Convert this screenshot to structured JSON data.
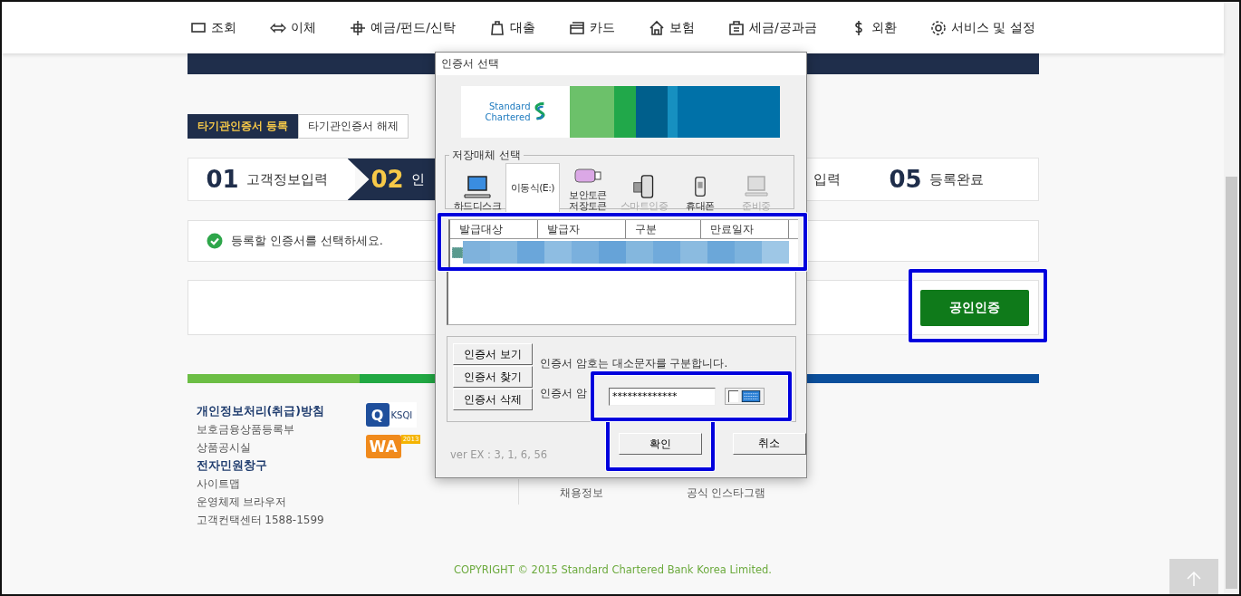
{
  "nav": [
    {
      "label": "조회"
    },
    {
      "label": "이체"
    },
    {
      "label": "예금/펀드/신탁"
    },
    {
      "label": "대출"
    },
    {
      "label": "카드"
    },
    {
      "label": "보험"
    },
    {
      "label": "세금/공과금"
    },
    {
      "label": "외환"
    },
    {
      "label": "서비스 및 설정"
    }
  ],
  "tabs": [
    {
      "label": "타기관인증서 등록",
      "selected": true
    },
    {
      "label": "타기관인증서 해제",
      "selected": false
    }
  ],
  "steps": [
    {
      "number": "01",
      "label": "고객정보입력",
      "selected": false
    },
    {
      "number": "02",
      "label": "인",
      "selected": true
    },
    {
      "label": "입력",
      "selected": false
    },
    {
      "number": "05",
      "label": "등록완료",
      "selected": false
    }
  ],
  "notice": "등록할 인증서를 선택하세요.",
  "certify_button": "공인인증",
  "footer": {
    "links": [
      {
        "label": "개인정보처리(취급)방침",
        "bold": true
      },
      {
        "label": "보호금융상품등록부",
        "bold": false
      },
      {
        "label": "상품공시실",
        "bold": false
      },
      {
        "label": "전자민원창구",
        "bold": true
      },
      {
        "label": "사이트맵",
        "bold": false
      },
      {
        "label": "운영체제 브라우저",
        "bold": false
      },
      {
        "label": "고객컨택센터 1588-1599",
        "bold": false
      }
    ],
    "badges": [
      {
        "mark": "Q",
        "label": "KSQI"
      },
      {
        "label": "WA",
        "year": "2013"
      }
    ],
    "extra_links": [
      "채용정보",
      "공식 인스타그램"
    ],
    "copyright": "COPYRIGHT © 2015 Standard Chartered Bank Korea Limited."
  },
  "dialog": {
    "title": "인증서 선택",
    "logo": [
      "Standard",
      "Chartered"
    ],
    "media_title": "저장매체 선택",
    "media": [
      {
        "label": "하드디스크",
        "selected": false,
        "disabled": false
      },
      {
        "label": "이동식(E:)",
        "selected": true,
        "disabled": false
      },
      {
        "label": "보안토큰 저장토큰",
        "selected": false,
        "disabled": false
      },
      {
        "label": "스마트인증",
        "selected": false,
        "disabled": true
      },
      {
        "label": "휴대폰",
        "selected": false,
        "disabled": false
      },
      {
        "label": "준비중",
        "selected": false,
        "disabled": true
      }
    ],
    "columns": [
      "발급대상",
      "발급자",
      "구분",
      "만료일자"
    ],
    "cert_buttons": [
      "인증서 보기",
      "인증서 찾기",
      "인증서 삭제"
    ],
    "hint": "인증서 암호는 대소문자를 구분합니다.",
    "password_label": "인증서 암",
    "password": "*************",
    "keyboard_checked": false,
    "ok": "확인",
    "cancel": "취소",
    "version": "ver EX : 3, 1, 6, 56"
  }
}
